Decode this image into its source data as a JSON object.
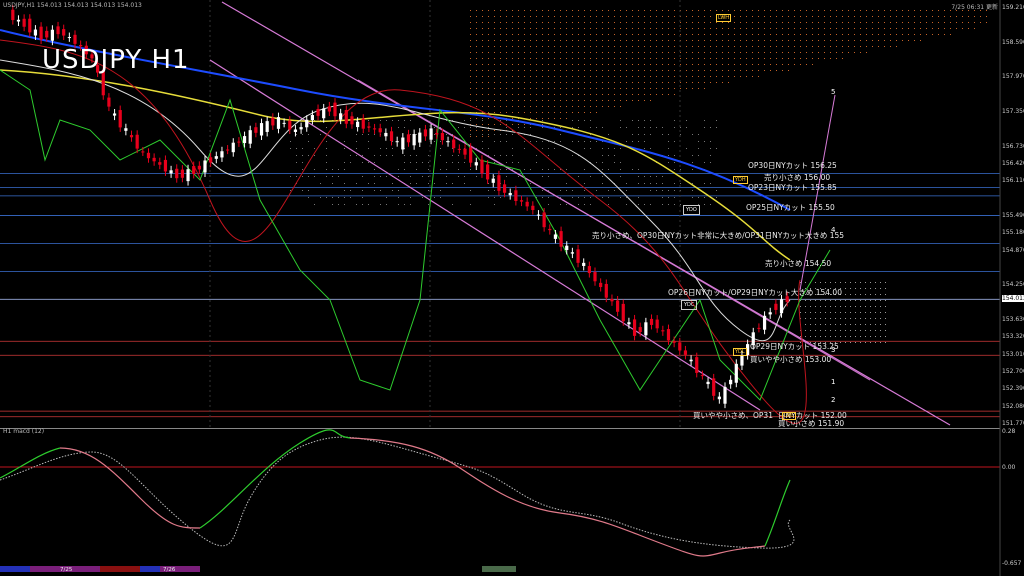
{
  "header": {
    "symbol_line": "USDJPY,H1  154.013 154.013 154.013 154.013",
    "datetime": "7/25 06:31 更新"
  },
  "title": "USDJPY H1",
  "macd_label": "H1  macd (12)",
  "macd_axis": {
    "top": "0.28",
    "zero": "0.00",
    "bottom": "-0.657"
  },
  "price_labels": [
    "159.210",
    "158.590",
    "157.970",
    "157.350",
    "156.730",
    "156.420",
    "156.110",
    "155.490",
    "155.180",
    "154.870",
    "154.250",
    "154.013",
    "153.630",
    "153.320",
    "153.010",
    "152.700",
    "152.390",
    "152.080",
    "151.770"
  ],
  "current_price": "154.013",
  "annotations": [
    {
      "text": "OP30日NYカット 156.25"
    },
    {
      "text": "売り小さめ 156.00"
    },
    {
      "text": "OP23日NYカット 155.85"
    },
    {
      "text": "OP25日NYカット 155.50"
    },
    {
      "text": "売り小さめ、OP30日NYカット非常に大きめ/OP31日NYカット大きめ 155"
    },
    {
      "text": "売り小さめ 154.50"
    },
    {
      "text": "OP26日NYカット/OP29日NYカット大きめ 154.00"
    },
    {
      "text": "OP29日NYカット 153.25"
    },
    {
      "text": "買いやや小さめ 153.00"
    },
    {
      "text": "買いやや小さめ、OP31"
    },
    {
      "text": "日NYカット 152.00"
    },
    {
      "text": "買い小さめ 151.90"
    }
  ],
  "wave_numbers": [
    "5",
    "4",
    "3",
    "1",
    "2"
  ],
  "box_labels": {
    "lwh": "LWH",
    "ydh": "YDH",
    "ydo": "YDO",
    "ydc": "YDC",
    "ydl": "YDL",
    "lwl": "LWL"
  },
  "dates": [
    "7/25",
    "7/26"
  ],
  "colors": {
    "bg": "#000000",
    "bull": "#ffffff",
    "bear": "#e8001c",
    "ma_yellow": "#e6dc3a",
    "ma_blue": "#1d4cff",
    "ma_white": "#dddddd",
    "macd": "#2ecc2e",
    "macd_neg": "#e07a8a",
    "channel": "#d77bd7",
    "cloud": "#c86428",
    "support": "#3a6fd0",
    "resist": "#d23a3a"
  },
  "chart_data": {
    "type": "candlestick",
    "title": "USDJPY H1",
    "ylim": [
      151.77,
      159.21
    ],
    "close_series": [
      159.1,
      158.9,
      158.7,
      158.8,
      158.6,
      158.3,
      157.4,
      157.0,
      156.6,
      156.4,
      156.2,
      156.3,
      156.5,
      156.7,
      156.9,
      157.1,
      157.2,
      157.0,
      157.3,
      157.4,
      157.2,
      157.1,
      157.0,
      156.8,
      156.9,
      157.0,
      156.8,
      156.6,
      156.3,
      156.0,
      155.8,
      155.6,
      155.2,
      154.9,
      154.6,
      154.2,
      153.8,
      153.4,
      153.6,
      153.3,
      153.0,
      152.6,
      152.2,
      152.8,
      153.4,
      153.8,
      154.01
    ],
    "levels": [
      156.25,
      156.0,
      155.85,
      155.5,
      155.0,
      154.5,
      154.0,
      153.25,
      153.0,
      152.0,
      151.9
    ],
    "macd_range": [
      -0.657,
      0.28
    ]
  }
}
